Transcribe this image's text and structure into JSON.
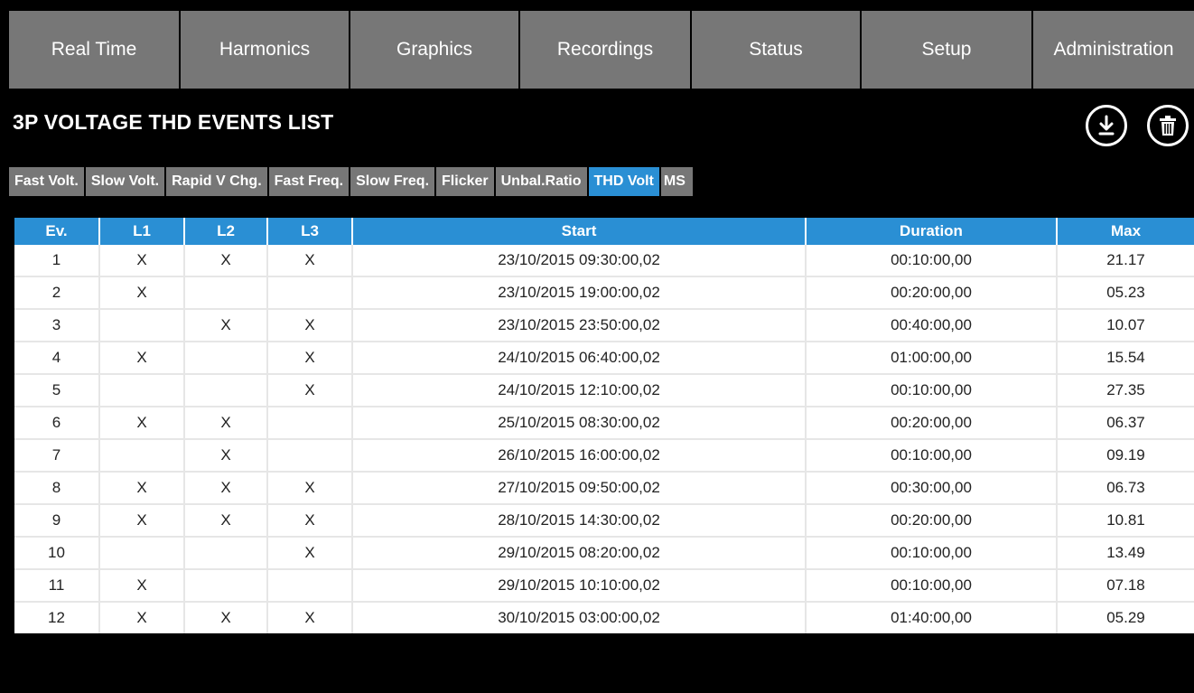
{
  "nav": {
    "tabs": [
      {
        "label": "Real Time"
      },
      {
        "label": "Harmonics"
      },
      {
        "label": "Graphics"
      },
      {
        "label": "Recordings"
      },
      {
        "label": "Status"
      },
      {
        "label": "Setup"
      },
      {
        "label": "Administration"
      }
    ]
  },
  "page": {
    "title": "3P VOLTAGE THD EVENTS LIST",
    "icons": [
      "download-icon",
      "trash-icon"
    ]
  },
  "subtabs": [
    {
      "label": "Fast Volt."
    },
    {
      "label": "Slow Volt."
    },
    {
      "label": "Rapid V Chg."
    },
    {
      "label": "Fast Freq."
    },
    {
      "label": "Slow Freq."
    },
    {
      "label": "Flicker"
    },
    {
      "label": "Unbal.Ratio"
    },
    {
      "label": "THD Volt",
      "active": true
    },
    {
      "label": "MS"
    }
  ],
  "colors": {
    "accent": "#2a8fd4",
    "tab_bg": "#777777",
    "background": "#000000"
  },
  "table": {
    "headers": [
      "Ev.",
      "L1",
      "L2",
      "L3",
      "Start",
      "Duration",
      "Max"
    ],
    "rows": [
      [
        "1",
        "X",
        "X",
        "X",
        "23/10/2015 09:30:00,02",
        "00:10:00,00",
        "21.17"
      ],
      [
        "2",
        "X",
        "",
        "",
        "23/10/2015 19:00:00,02",
        "00:20:00,00",
        "05.23"
      ],
      [
        "3",
        "",
        "X",
        "X",
        "23/10/2015 23:50:00,02",
        "00:40:00,00",
        "10.07"
      ],
      [
        "4",
        "X",
        "",
        "X",
        "24/10/2015 06:40:00,02",
        "01:00:00,00",
        "15.54"
      ],
      [
        "5",
        "",
        "",
        "X",
        "24/10/2015 12:10:00,02",
        "00:10:00,00",
        "27.35"
      ],
      [
        "6",
        "X",
        "X",
        "",
        "25/10/2015 08:30:00,02",
        "00:20:00,00",
        "06.37"
      ],
      [
        "7",
        "",
        "X",
        "",
        "26/10/2015 16:00:00,02",
        "00:10:00,00",
        "09.19"
      ],
      [
        "8",
        "X",
        "X",
        "X",
        "27/10/2015 09:50:00,02",
        "00:30:00,00",
        "06.73"
      ],
      [
        "9",
        "X",
        "X",
        "X",
        "28/10/2015 14:30:00,02",
        "00:20:00,00",
        "10.81"
      ],
      [
        "10",
        "",
        "",
        "X",
        "29/10/2015 08:20:00,02",
        "00:10:00,00",
        "13.49"
      ],
      [
        "11",
        "X",
        "",
        "",
        "29/10/2015 10:10:00,02",
        "00:10:00,00",
        "07.18"
      ],
      [
        "12",
        "X",
        "X",
        "X",
        "30/10/2015 03:00:00,02",
        "01:40:00,00",
        "05.29"
      ]
    ]
  }
}
